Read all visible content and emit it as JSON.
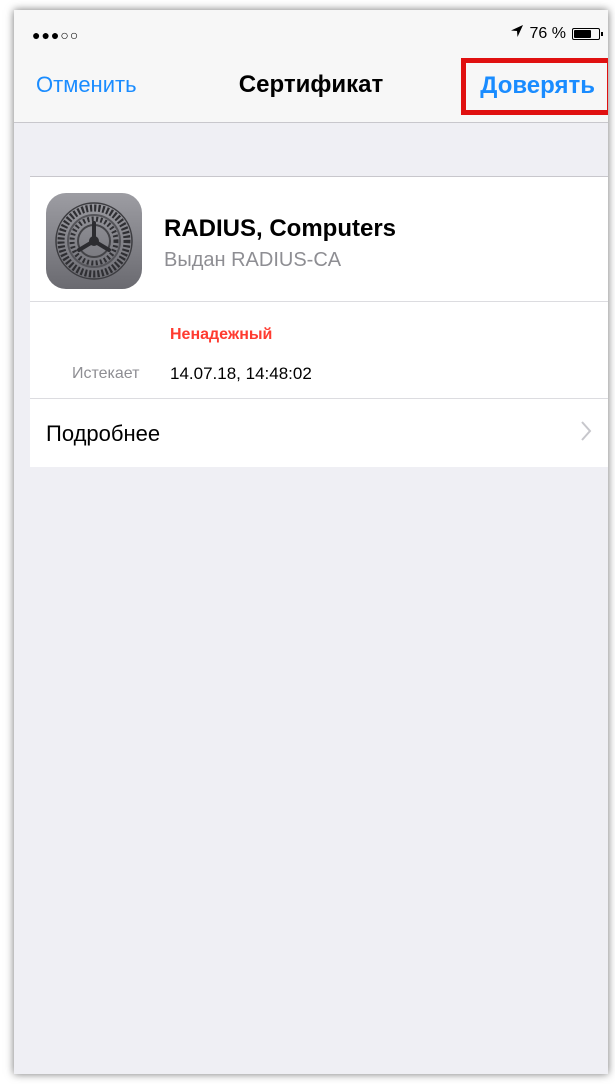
{
  "status_bar": {
    "signal": "●●●○○",
    "battery_percent": "76 %",
    "battery_level": 0.76,
    "location_icon": "location-arrow-icon",
    "battery_icon": "battery-icon"
  },
  "nav": {
    "cancel_label": "Отменить",
    "title": "Сертификат",
    "trust_label": "Доверять",
    "highlight_color": "#e01010",
    "accent_color": "#1a8cff"
  },
  "certificate": {
    "icon": "settings-gear-icon",
    "name": "RADIUS, Computers",
    "issuer": "Выдан RADIUS-CA",
    "trust_status": "Ненадежный",
    "trust_status_color": "#ff3b30",
    "expires_label": "Истекает",
    "expires_value": "14.07.18, 14:48:02"
  },
  "more": {
    "label": "Подробнее",
    "chevron": "chevron-right-icon"
  }
}
